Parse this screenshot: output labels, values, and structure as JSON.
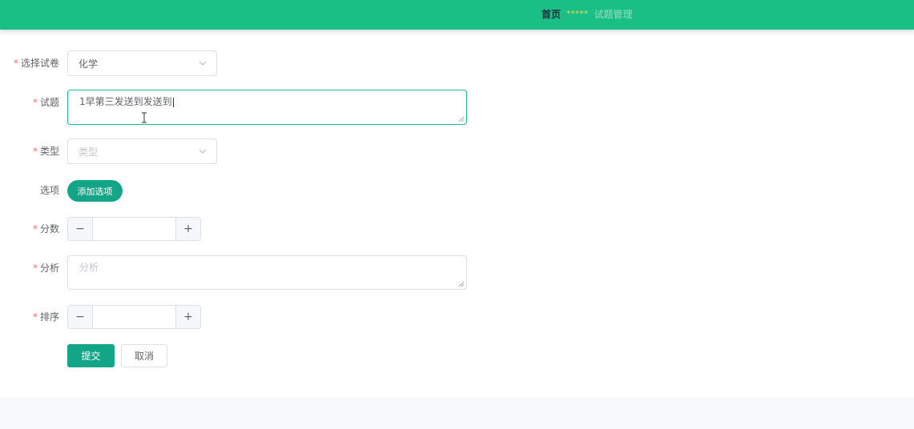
{
  "breadcrumb": {
    "home": "首页",
    "separator": "*****",
    "current": "试题管理"
  },
  "form": {
    "paper": {
      "label": "选择试卷",
      "value": "化学"
    },
    "question": {
      "label": "试题",
      "value": "1早第三发送到发送到"
    },
    "type": {
      "label": "类型",
      "placeholder": "类型"
    },
    "options": {
      "label": "选项",
      "add_button": "添加选项"
    },
    "score": {
      "label": "分数",
      "value": "",
      "dec": "−",
      "inc": "+"
    },
    "analysis": {
      "label": "分析",
      "placeholder": "分析"
    },
    "order": {
      "label": "排序",
      "value": "",
      "dec": "−",
      "inc": "+"
    },
    "required_mark": "*"
  },
  "actions": {
    "submit": "提交",
    "cancel": "取消"
  },
  "colors": {
    "header": "#1abf85",
    "primary": "#13a587",
    "required": "#f56c6c"
  },
  "icons": {
    "select_arrow": "chevron-down-icon",
    "resize": "resize-handle-icon",
    "cursor": "text-cursor-icon"
  }
}
